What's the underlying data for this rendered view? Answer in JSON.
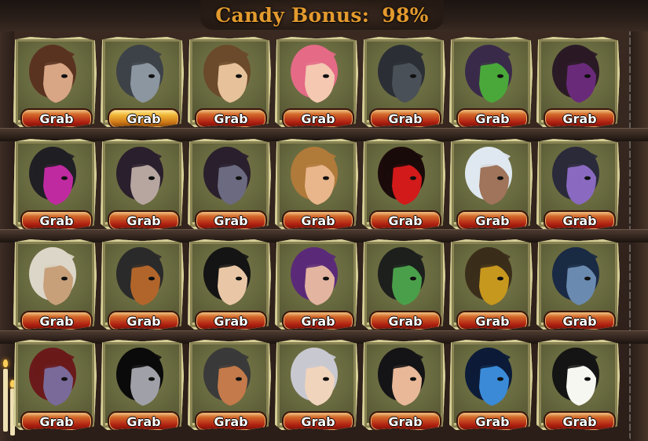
{
  "header": {
    "label": "Candy Bonus:",
    "value": "98%"
  },
  "colors": {
    "title": "#e39a2e",
    "tile_paper": "#c9be80",
    "grab_red": "#b02212",
    "grab_highlight": "#f0b637"
  },
  "grab_label": "Grab",
  "rows": [
    [
      {
        "name": "long-brown-hair-elf-portrait",
        "icon": "elf-male-long-hair"
      },
      {
        "name": "horned-steel-helmet-portrait",
        "icon": "dark-knight-helmet",
        "highlight": true
      },
      {
        "name": "brown-hair-woman-portrait",
        "icon": "woman-brown-hair"
      },
      {
        "name": "pink-hair-crowned-portrait",
        "icon": "pink-hair-princess"
      },
      {
        "name": "bat-creature-portrait",
        "icon": "bat-head"
      },
      {
        "name": "purple-green-dragon-portrait",
        "icon": "dragon-head"
      },
      {
        "name": "purple-hooded-beast-portrait",
        "icon": "beast-hood"
      }
    ],
    [
      {
        "name": "magenta-eye-helmet-portrait",
        "icon": "cyber-helmet"
      },
      {
        "name": "braided-hair-dark-elf-portrait",
        "icon": "dark-elf-braids"
      },
      {
        "name": "braided-hair-blue-eye-portrait",
        "icon": "dark-elf-braids-blue"
      },
      {
        "name": "blonde-man-portrait",
        "icon": "man-blonde-hair"
      },
      {
        "name": "red-many-eyes-creature-portrait",
        "icon": "red-eyes-blob"
      },
      {
        "name": "white-hair-glasses-portrait",
        "icon": "white-hair-glasses"
      },
      {
        "name": "cosmic-skull-portrait",
        "icon": "cosmic-head"
      }
    ],
    [
      {
        "name": "white-maned-lion-portrait",
        "icon": "lion-elder"
      },
      {
        "name": "orange-hooded-warrior-portrait",
        "icon": "hooded-warrior"
      },
      {
        "name": "black-hair-portrait",
        "icon": "black-hair-man"
      },
      {
        "name": "purple-hair-rose-portrait",
        "icon": "purple-hair-woman"
      },
      {
        "name": "green-eye-zombie-portrait",
        "icon": "zombie-head"
      },
      {
        "name": "golden-chainsaw-helmet-portrait",
        "icon": "golden-helmet"
      },
      {
        "name": "blue-hair-steampunk-portrait",
        "icon": "steampunk-woman"
      }
    ],
    [
      {
        "name": "red-hair-ram-horn-portrait",
        "icon": "red-hair-horns"
      },
      {
        "name": "clockwork-silhouette-portrait",
        "icon": "gear-silhouette"
      },
      {
        "name": "witch-hat-portrait",
        "icon": "witch-hat"
      },
      {
        "name": "silver-hair-portrait",
        "icon": "silver-hair-man"
      },
      {
        "name": "black-red-spiky-hair-portrait",
        "icon": "spiky-hair-man"
      },
      {
        "name": "starry-manta-portrait",
        "icon": "cosmic-manta"
      },
      {
        "name": "clown-portrait",
        "icon": "clown-face"
      }
    ]
  ]
}
